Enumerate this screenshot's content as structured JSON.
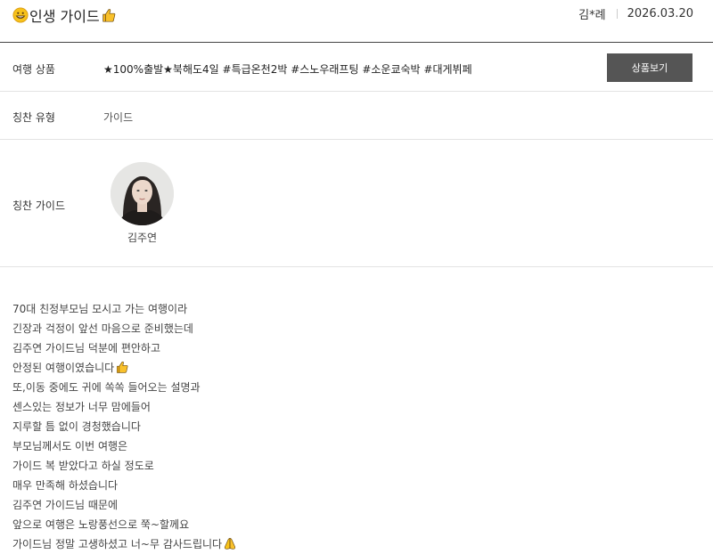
{
  "post": {
    "title": "인생 가이드",
    "author": "김*례",
    "date": "2026.03.20",
    "title_icons": {
      "leading": "grinning-face-icon",
      "trailing": "thumbs-up-icon"
    }
  },
  "product": {
    "label": "여행 상품",
    "name": "★100%출발★북해도4일 #특급온천2박 #스노우래프팅 #소운쿄숙박 #대게뷔페",
    "button_label": "상품보기",
    "button_color": "#555555"
  },
  "praise_type": {
    "label": "칭찬 유형",
    "value": "가이드"
  },
  "praise_guide": {
    "label": "칭찬 가이드",
    "guide_name": "김주연"
  },
  "body_lines": [
    "70대 친정부모님 모시고 가는 여행이라",
    "긴장과 걱정이 앞선 마음으로 준비했는데",
    "김주연 가이드님 덕분에 편안하고",
    "안정된 여행이였습니다",
    "또,이동 중에도 귀에 쏙쏙 들어오는 설명과",
    "센스있는 정보가 너무 맘에들어",
    "지루할 틈 없이 경청했습니다",
    "부모님께서도 이번 여행은",
    "가이드 복 받았다고 하실 정도로",
    "매우 만족해 하셨습니다",
    "김주연 가이드님 때문에",
    "앞으로 여행은 노랑풍선으로 쭉~할께요",
    "가이드님 정말 고생하셨고 너~무 감사드립니다"
  ],
  "body_line_icons": {
    "3": "thumbs-up-icon",
    "12": "folded-hands-icon"
  }
}
